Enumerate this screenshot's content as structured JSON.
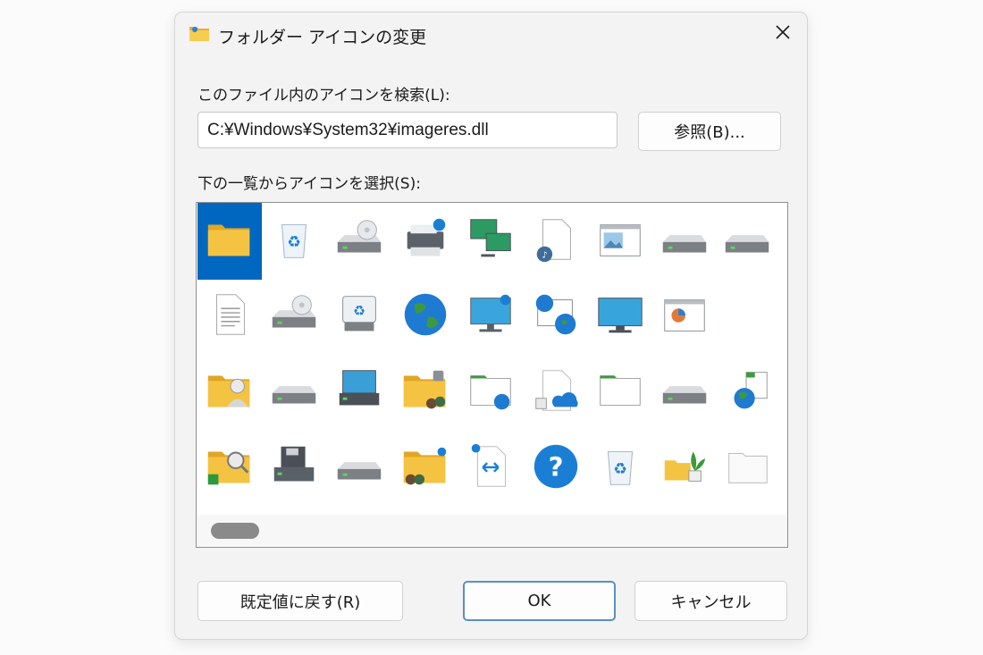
{
  "window": {
    "title": "フォルダー アイコンの変更",
    "close_icon": "close-icon"
  },
  "search": {
    "label": "このファイル内のアイコンを検索(L):",
    "path_value": "C:¥Windows¥System32¥imageres.dll",
    "browse_label": "参照(B)..."
  },
  "list": {
    "label": "下の一覧からアイコンを選択(S):",
    "selected_icon": "folder-icon",
    "icons": [
      [
        "folder-icon",
        "recycle-bin-empty-icon",
        "cd-drive-icon",
        "printer-icon",
        "network-computers-icon",
        "music-file-icon",
        "picture-window-icon",
        "drive-icon",
        "drive-icon"
      ],
      [
        "document-icon",
        "cd-drive-icon",
        "recycle-drive-icon",
        "globe-icon",
        "monitor-shortcut-icon",
        "network-globe-icon",
        "monitor-icon",
        "presentation-window-icon"
      ],
      [
        "user-folder-icon",
        "drive-icon",
        "network-drive-icon",
        "shared-folder-icon",
        "folder-network-icon",
        "cloud-file-icon",
        "folder-window-icon",
        "drive-icon",
        "globe-folder-icon"
      ],
      [
        "search-folder-icon",
        "floppy-drive-icon",
        "drive-icon",
        "group-folder-icon",
        "sync-file-icon",
        "help-icon",
        "recycle-bin-full-icon",
        "plant-folder-icon",
        "blank-folder-icon"
      ]
    ]
  },
  "footer": {
    "restore_label": "既定値に戻す(R)",
    "ok_label": "OK",
    "cancel_label": "キャンセル"
  },
  "colors": {
    "selection": "#0067c0",
    "folder_yellow": "#f5c342",
    "accent_border": "#5b8fc7"
  }
}
